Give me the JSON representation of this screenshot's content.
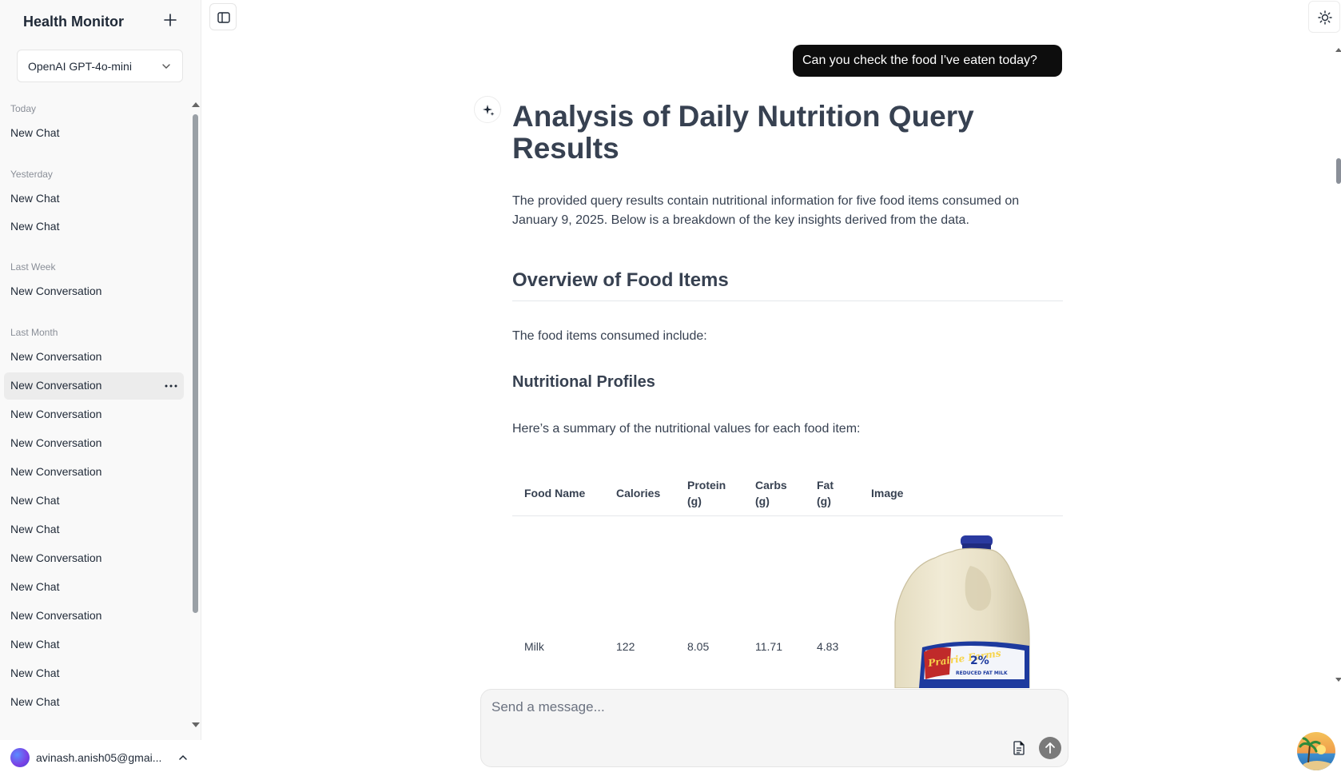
{
  "sidebar": {
    "app_title": "Health Monitor",
    "model": "OpenAI GPT-4o-mini",
    "groups": [
      {
        "label": "Today",
        "items": [
          "New Chat"
        ]
      },
      {
        "label": "Yesterday",
        "items": [
          "New Chat",
          "New Chat"
        ]
      },
      {
        "label": "Last Week",
        "items": [
          "New Conversation"
        ]
      },
      {
        "label": "Last Month",
        "items": [
          "New Conversation",
          "New Conversation",
          "New Conversation",
          "New Conversation",
          "New Conversation",
          "New Chat",
          "New Chat",
          "New Conversation",
          "New Chat",
          "New Conversation",
          "New Chat",
          "New Chat",
          "New Chat"
        ]
      }
    ],
    "user_email": "avinash.anish05@gmai..."
  },
  "chat": {
    "user_message": "Can you check the food I've eaten today?",
    "title": "Analysis of Daily Nutrition Query Results",
    "intro": "The provided query results contain nutritional information for five food items consumed on January 9, 2025. Below is a breakdown of the key insights derived from the data.",
    "section_heading": "Overview of Food Items",
    "section_text": "The food items consumed include:",
    "sub_heading": "Nutritional Profiles",
    "sub_text": "Here’s a summary of the nutritional values for each food item:",
    "table": {
      "headers": {
        "food": "Food Name",
        "calories": "Calories",
        "protein_1": "Protein",
        "protein_2": "(g)",
        "carbs_1": "Carbs",
        "carbs_2": "(g)",
        "fat_1": "Fat",
        "fat_2": "(g)",
        "image": "Image"
      },
      "rows": [
        {
          "food": "Milk",
          "calories": "122",
          "protein": "8.05",
          "carbs": "11.71",
          "fat": "4.83",
          "image_text_1": "Prairie Farms",
          "image_text_2": "2%",
          "image_text_3": "REDUCED FAT MILK"
        }
      ]
    }
  },
  "composer": {
    "placeholder": "Send a message..."
  },
  "icons": {
    "new_chat": "plus-icon",
    "model_chevron": "chevron-down-icon",
    "sidebar_toggle": "sidebar-icon",
    "theme": "sun-icon",
    "assistant": "sparkle-icon",
    "attach": "document-icon",
    "send": "arrow-up-icon"
  }
}
